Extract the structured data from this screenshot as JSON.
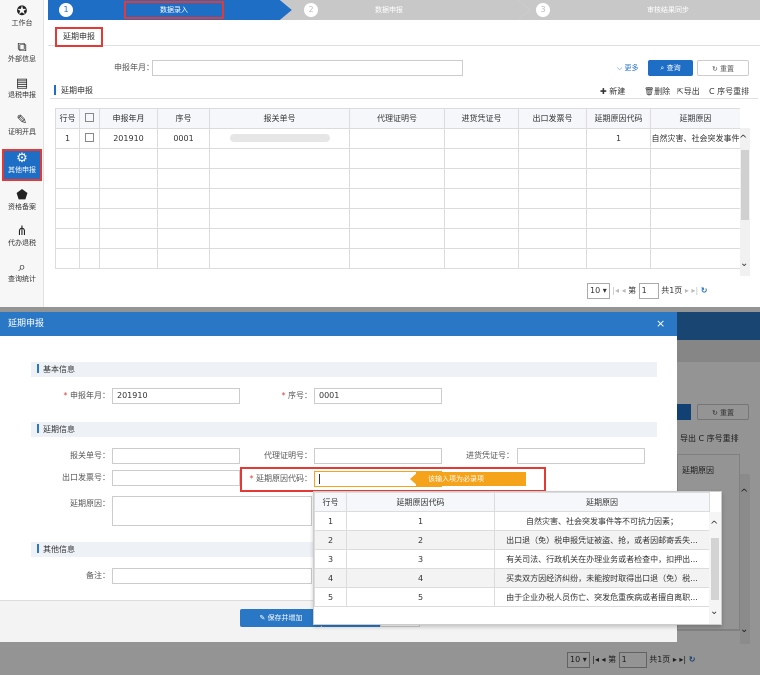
{
  "sidebar": {
    "items": [
      {
        "icon": "dashboard-icon",
        "glyph": "✪",
        "label": "工作台"
      },
      {
        "icon": "external-info-icon",
        "glyph": "⧉",
        "label": "外部信息"
      },
      {
        "icon": "document-icon",
        "glyph": "▤",
        "label": "退税申报"
      },
      {
        "icon": "edit-icon",
        "glyph": "✎",
        "label": "证明开具"
      },
      {
        "icon": "gears-icon",
        "glyph": "⚙",
        "label": "其他申报"
      },
      {
        "icon": "shield-icon",
        "glyph": "⬟",
        "label": "资格备案"
      },
      {
        "icon": "org-chart-icon",
        "glyph": "⋔",
        "label": "代办退税"
      },
      {
        "icon": "search-icon",
        "glyph": "⌕",
        "label": "查询统计"
      }
    ]
  },
  "steps": [
    {
      "num": "1",
      "label": "数据录入"
    },
    {
      "num": "2",
      "label": "数据申报"
    },
    {
      "num": "3",
      "label": "审核结果同步"
    }
  ],
  "tab": {
    "label": "延期申报"
  },
  "search": {
    "label": "申报年月：",
    "value": "",
    "more": "更多",
    "query": "查询",
    "reset": "重置"
  },
  "grid": {
    "title": "延期申报",
    "actions": {
      "new": "新建",
      "delete": "删除",
      "export": "导出",
      "reorder": "序号重排"
    },
    "columns": [
      "行号",
      "",
      "申报年月",
      "序号",
      "报关单号",
      "代理证明号",
      "进货凭证号",
      "出口发票号",
      "延期原因代码",
      "延期原因"
    ],
    "rows": [
      [
        "1",
        "",
        "201910",
        "0001",
        "",
        "",
        "",
        "",
        "1",
        "自然灾害、社会突发事件"
      ]
    ]
  },
  "pager": {
    "size": "10",
    "page_prefix": "第",
    "page": "1",
    "total": "共1页"
  },
  "modal": {
    "title": "延期申报",
    "close": "×",
    "basic": {
      "title": "基本信息",
      "ym_label": "申报年月：",
      "ym_value": "201910",
      "seq_label": "序号：",
      "seq_value": "0001"
    },
    "delay": {
      "title": "延期信息",
      "customs_label": "报关单号：",
      "agent_label": "代理证明号：",
      "purchase_label": "进货凭证号：",
      "invoice_label": "出口发票号：",
      "reason_code_label": "延期原因代码：",
      "reason_label": "延期原因：",
      "tooltip": "该输入项为必录项"
    },
    "other": {
      "title": "其他信息",
      "remark_label": "备注："
    },
    "save_add": "保存并增加"
  },
  "dropdown": {
    "columns": [
      "行号",
      "延期原因代码",
      "延期原因"
    ],
    "rows": [
      [
        "1",
        "1",
        "自然灾害、社会突发事件等不可抗力因素；"
      ],
      [
        "2",
        "2",
        "出口退（免）税申报凭证被盗、抢，或者因邮寄丢失..."
      ],
      [
        "3",
        "3",
        "有关司法、行政机关在办理业务或者检查中，扣押出..."
      ],
      [
        "4",
        "4",
        "买卖双方因经济纠纷，未能按时取得出口退（免）税..."
      ],
      [
        "5",
        "5",
        "由于企业办税人员伤亡、突发危重疾病或者擅自离职..."
      ]
    ]
  },
  "bg_partial": {
    "reset": "重置",
    "export_reorder": "导出  C 序号重排",
    "col": "延期原因"
  },
  "colors": {
    "primary": "#1e6ec5",
    "modal_header": "#2a78c5",
    "highlight": "#e53935",
    "tooltip": "#f5a31a"
  }
}
